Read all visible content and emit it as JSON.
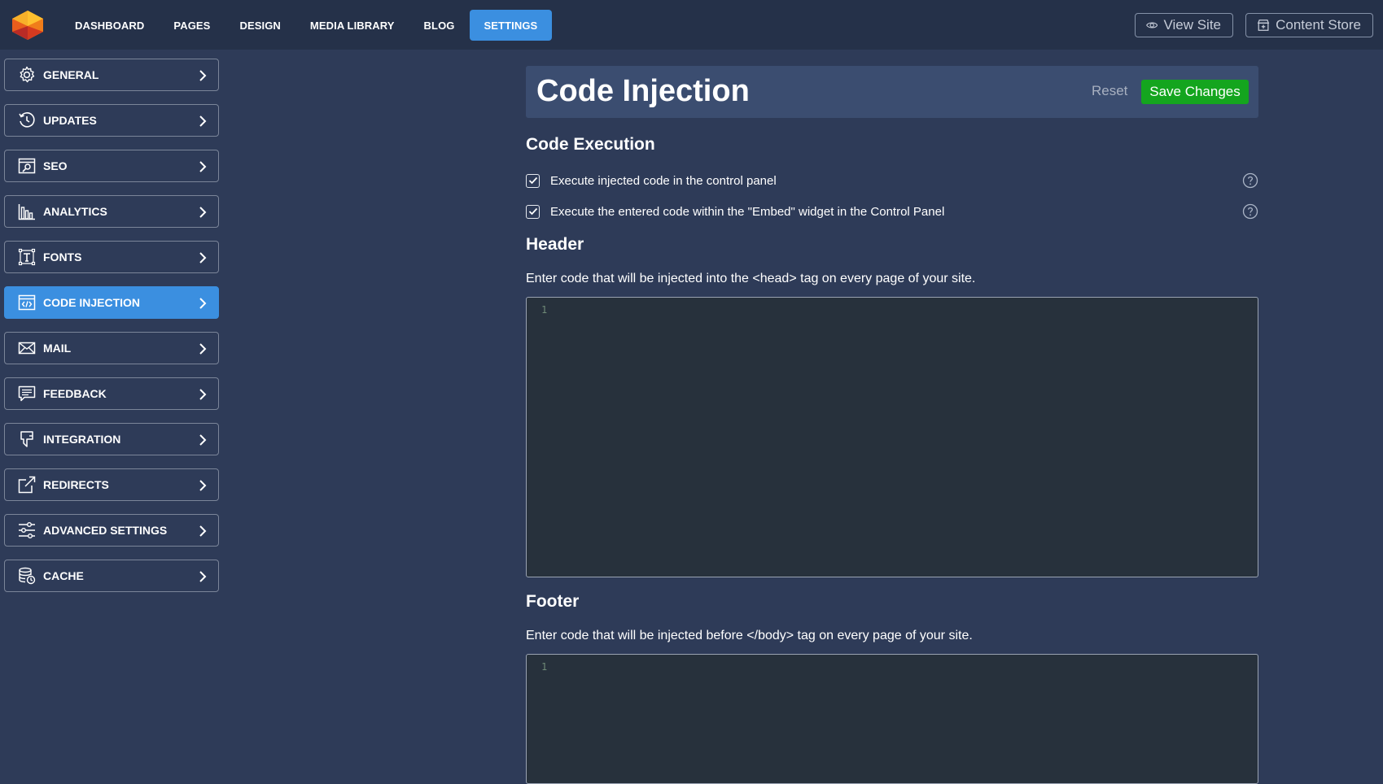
{
  "nav": {
    "items": [
      {
        "label": "DASHBOARD",
        "active": false
      },
      {
        "label": "PAGES",
        "active": false
      },
      {
        "label": "DESIGN",
        "active": false
      },
      {
        "label": "MEDIA LIBRARY",
        "active": false
      },
      {
        "label": "BLOG",
        "active": false
      },
      {
        "label": "SETTINGS",
        "active": true
      }
    ],
    "view_site": "View Site",
    "content_store": "Content Store"
  },
  "sidebar": {
    "items": [
      {
        "label": "GENERAL",
        "icon": "gear-icon"
      },
      {
        "label": "UPDATES",
        "icon": "history-icon"
      },
      {
        "label": "SEO",
        "icon": "seo-icon"
      },
      {
        "label": "ANALYTICS",
        "icon": "bar-chart-icon"
      },
      {
        "label": "FONTS",
        "icon": "font-icon"
      },
      {
        "label": "CODE INJECTION",
        "icon": "code-icon",
        "active": true
      },
      {
        "label": "MAIL",
        "icon": "mail-icon"
      },
      {
        "label": "FEEDBACK",
        "icon": "feedback-icon"
      },
      {
        "label": "INTEGRATION",
        "icon": "integration-icon"
      },
      {
        "label": "REDIRECTS",
        "icon": "redirect-icon"
      },
      {
        "label": "ADVANCED SETTINGS",
        "icon": "sliders-icon"
      },
      {
        "label": "CACHE",
        "icon": "cache-icon"
      }
    ]
  },
  "main": {
    "title": "Code Injection",
    "reset_label": "Reset",
    "save_label": "Save Changes",
    "code_execution": {
      "heading": "Code Execution",
      "options": [
        {
          "label": "Execute injected code in the control panel",
          "checked": true
        },
        {
          "label": "Execute the entered code within the \"Embed\" widget in the Control Panel",
          "checked": true
        }
      ]
    },
    "header": {
      "heading": "Header",
      "description": "Enter code that will be injected into the <head> tag on every page of your site.",
      "line_number": "1",
      "value": ""
    },
    "footer": {
      "heading": "Footer",
      "description": "Enter code that will be injected before </body> tag on every page of your site.",
      "line_number": "1",
      "value": ""
    }
  },
  "colors": {
    "background": "#2e3b58",
    "topbar": "#253149",
    "accent": "#3b8fe0",
    "save": "#14a51e",
    "editor": "#27313c"
  }
}
